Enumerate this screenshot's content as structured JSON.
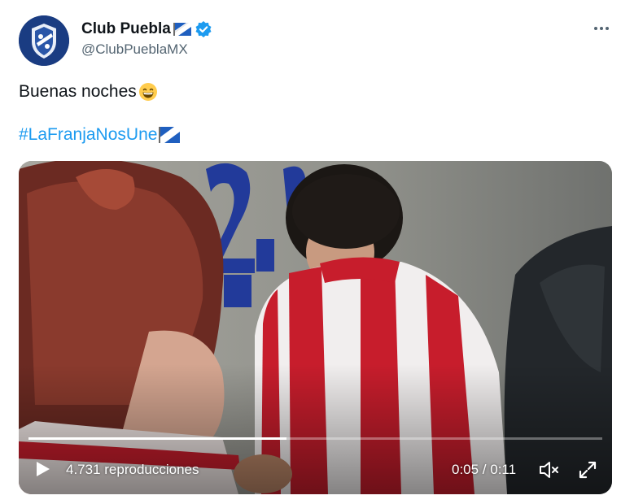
{
  "tweet": {
    "display_name": "Club Puebla",
    "handle": "@ClubPueblaMX",
    "text": "Buenas noches",
    "hashtag": "#LaFranjaNosUne",
    "icons": {
      "avatar": "club-puebla-crest",
      "name_flag": "puebla-stripe-flag-icon",
      "verified": "verified-badge-icon",
      "emoji": "grinning-face-emoji",
      "hashtag_flag": "puebla-stripe-flag-icon",
      "more": "more-dots-icon"
    },
    "colors": {
      "link": "#1d9bf0",
      "verified": "#1d9bf0",
      "secondary_text": "#536471"
    }
  },
  "video": {
    "views": "4.731 reproducciones",
    "time": "0:05 / 0:11",
    "progress_fraction": 0.45,
    "icons": {
      "play": "play-icon",
      "mute": "muted-speaker-icon",
      "fullscreen": "fullscreen-icon"
    }
  }
}
